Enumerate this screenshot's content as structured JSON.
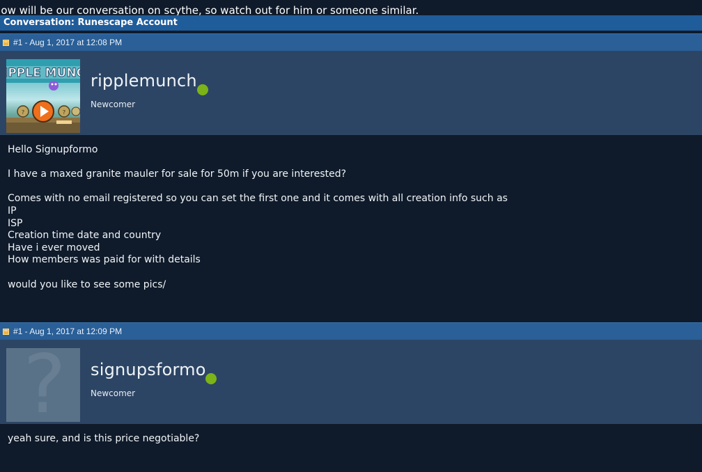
{
  "intro_text": "elow will be our conversation on scythe, so watch out for him or someone similar.",
  "conversation": {
    "title": "Conversation: Runescape Account"
  },
  "posts": [
    {
      "meta": "#1 - Aug 1, 2017 at 12:08 PM",
      "username": "ripplemunch",
      "rank": "Newcomer",
      "avatar_label": "IPPLE MUNC",
      "status_color": "#7cb318",
      "message": "Hello Signupformo\n\nI have a maxed granite mauler for sale for 50m if you are interested?\n\nComes with no email registered so you can set the first one and it comes with all creation info such as\nIP\nISP\nCreation time date and country\nHave i ever moved\nHow members was paid for with details\n\nwould you like to see some pics/"
    },
    {
      "meta": "#1 - Aug 1, 2017 at 12:09 PM",
      "username": "signupsformo",
      "rank": "Newcomer",
      "avatar_label": "?",
      "status_color": "#7cb318",
      "message": "yeah sure, and is this price negotiable?"
    }
  ]
}
